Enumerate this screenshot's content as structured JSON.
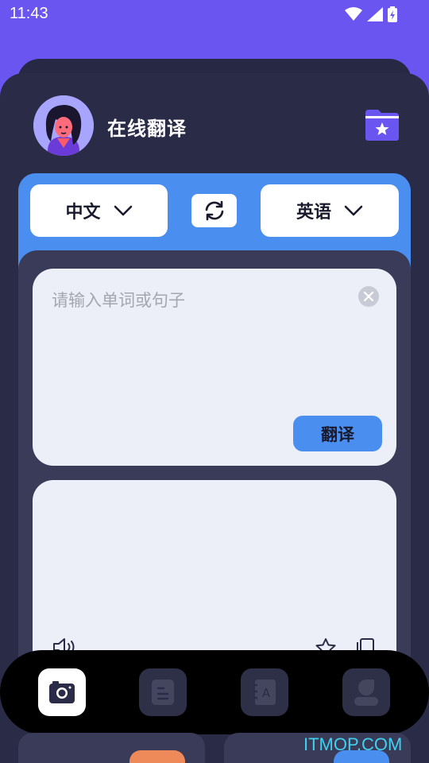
{
  "status_bar": {
    "time": "11:43"
  },
  "header": {
    "title": "在线翻译"
  },
  "languages": {
    "source": "中文",
    "target": "英语"
  },
  "input": {
    "placeholder": "请输入单词或句子",
    "translate_label": "翻译"
  },
  "watermark": "ITMOP.COM",
  "colors": {
    "purple_bg": "#6a55f0",
    "dark_sheet": "#2a2b46",
    "blue_accent": "#4a8ff0",
    "card_bg": "#eceef8"
  },
  "nav": {
    "items": [
      "camera-icon",
      "notes-icon",
      "dictionary-icon",
      "profile-icon"
    ],
    "active": 0
  }
}
